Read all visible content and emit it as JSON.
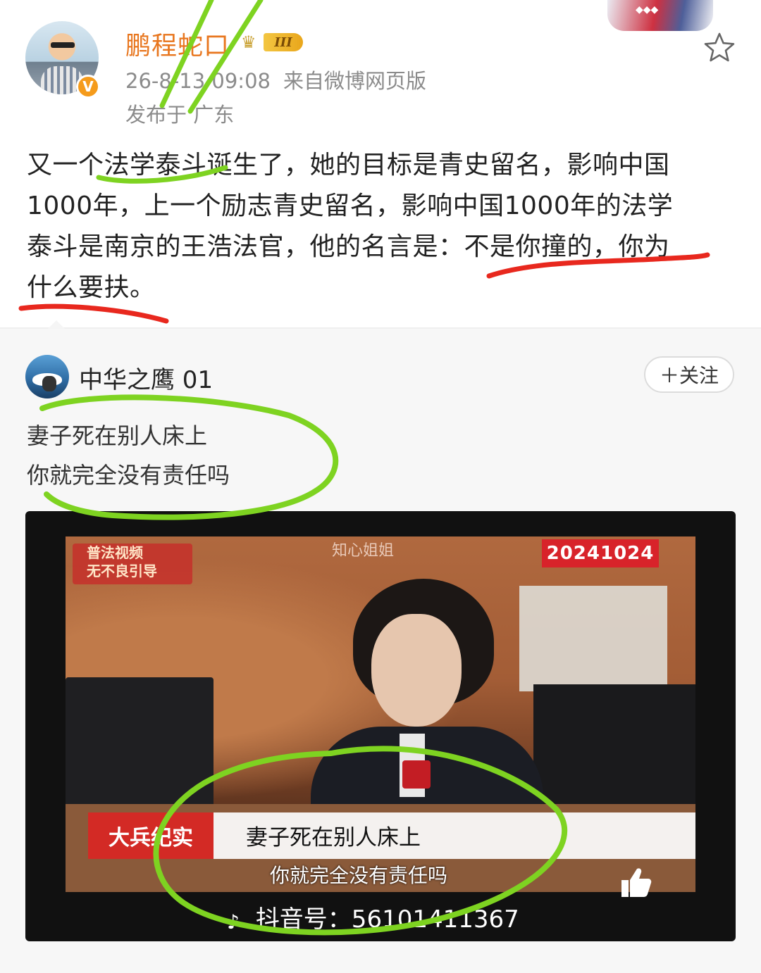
{
  "post": {
    "username": "鹏程蛇口",
    "level": "III",
    "date": "26-8-13 09:08",
    "source": "来自微博网页版",
    "location": "发布于 广东",
    "verified_mark": "V",
    "text_lines": [
      "又一个法学泰斗诞生了，她的目标是青史留名，影响中国",
      "1000年，上一个励志青史留名，影响中国1000年的法学",
      "泰斗是南京的王浩法官，他的名言是：不是你撞的，你为",
      "什么要扶。"
    ]
  },
  "repost": {
    "username": "中华之鹰 01",
    "follow_label": "＋关注",
    "lines": [
      "妻子死在别人床上",
      "你就完全没有责任吗"
    ]
  },
  "video": {
    "watermark_topleft": [
      "普法视频",
      "无不良引导"
    ],
    "watermark_center": "知心姐姐",
    "date_tag": "20241024",
    "bottom_tag": "大兵纪实",
    "caption_line1": "妻子死在别人床上",
    "caption_line2": "你就完全没有责任吗",
    "douyin_id": "抖音号：56101411367"
  },
  "colors": {
    "username": "#e8761e",
    "meta": "#8b8b8b",
    "annot_red": "#e8281e",
    "annot_green": "#7ed321",
    "tag_red": "#d32a25"
  },
  "icons": [
    "verified-icon",
    "crown-icon",
    "star-outline-icon",
    "douyin-icon",
    "thumbs-up-icon"
  ]
}
